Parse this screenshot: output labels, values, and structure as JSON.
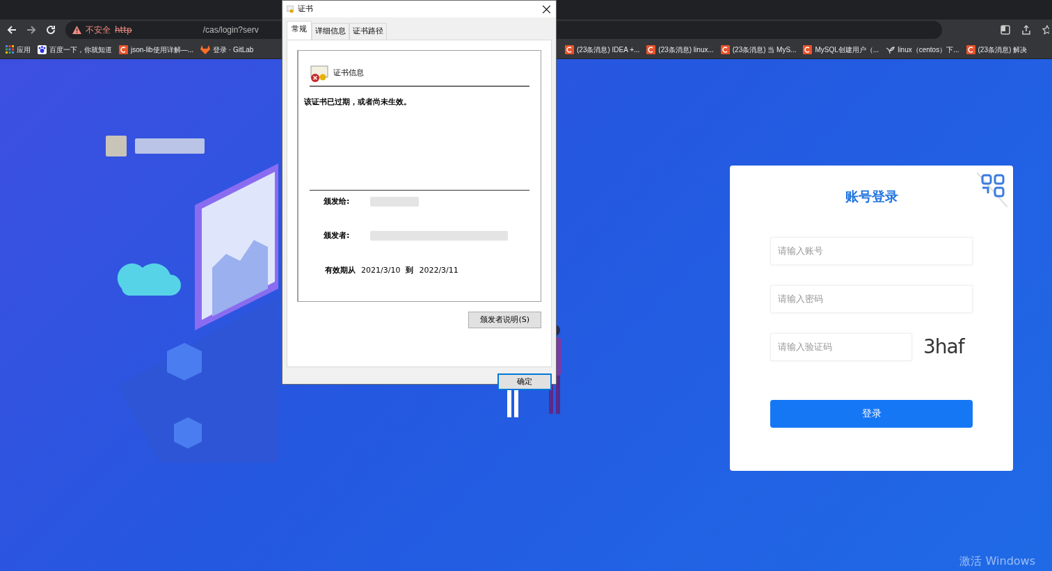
{
  "address_bar": {
    "warning": "不安全",
    "scheme": "http",
    "path": "/cas/login?serv"
  },
  "bookmarks": [
    {
      "kind": "apps",
      "label": "应用"
    },
    {
      "kind": "paw",
      "label": "百度一下，你就知道"
    },
    {
      "kind": "square",
      "label": "json-lib使用详解—..."
    },
    {
      "kind": "fox",
      "label": "登录 · GitLab"
    },
    {
      "kind": "square",
      "label": "(23条消息) IDEA +..."
    },
    {
      "kind": "square",
      "label": "(23条消息) linux..."
    },
    {
      "kind": "square",
      "label": "(23条消息) 当 MyS..."
    },
    {
      "kind": "square",
      "label": "MySQL创建用户（..."
    },
    {
      "kind": "leaf",
      "label": "linux（centos）下..."
    },
    {
      "kind": "square",
      "label": "(23条消息) 解决"
    }
  ],
  "dialog": {
    "title": "证书",
    "tabs": [
      {
        "label": "常规",
        "selected": true
      },
      {
        "label": "详细信息",
        "selected": false
      },
      {
        "label": "证书路径",
        "selected": false
      }
    ],
    "heading": "证书信息",
    "message": "该证书已过期，或者尚未生效。",
    "issued_to_label": "颁发给:",
    "issued_by_label": "颁发者:",
    "validity_label": "有效期从",
    "valid_from": "2021/3/10",
    "validity_to": "到",
    "valid_to": "2022/3/11",
    "issuer_statement_button": "颁发者说明(S)",
    "ok_button": "确定"
  },
  "login": {
    "title": "账号登录",
    "account_placeholder": "请输入账号",
    "password_placeholder": "请输入密码",
    "captcha_placeholder": "请输入验证码",
    "captcha": "3haf",
    "submit": "登录"
  },
  "os_notice": "激活 Windows"
}
